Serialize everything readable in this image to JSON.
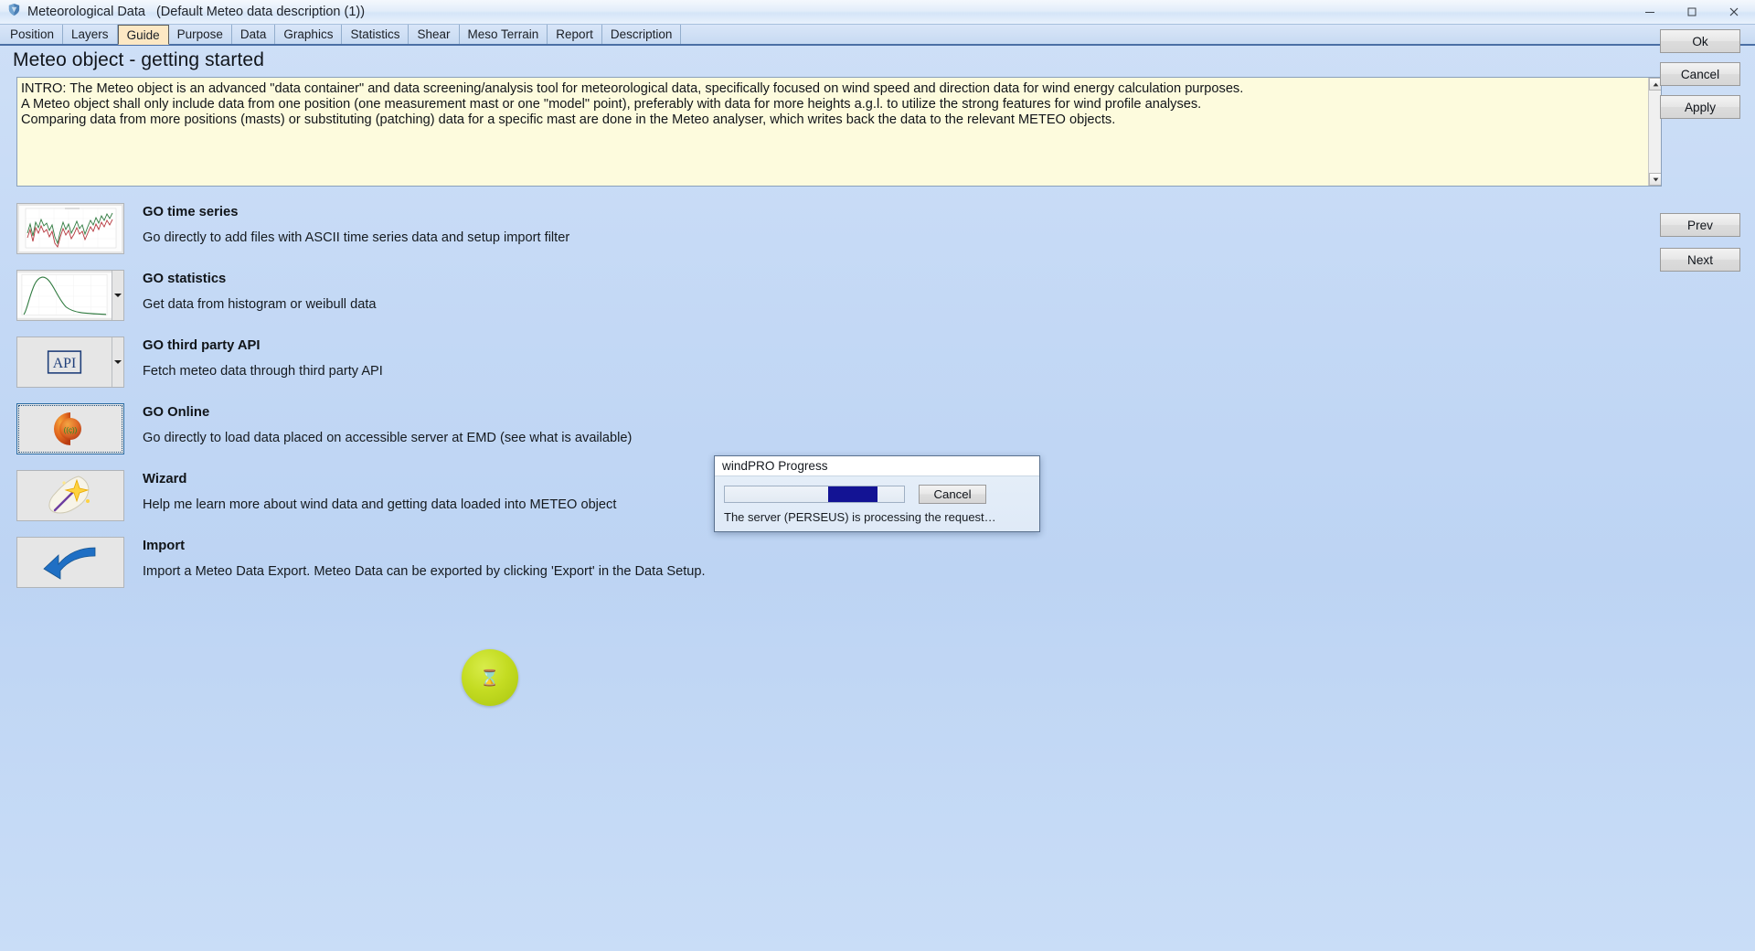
{
  "window": {
    "app_icon": "windpro-shield-icon",
    "title": "Meteorological Data",
    "subtitle": "(Default Meteo data description (1))",
    "minimize_label": "minimize-icon",
    "maximize_label": "maximize-icon",
    "close_label": "close-icon"
  },
  "tabs": [
    {
      "label": "Position",
      "active": false
    },
    {
      "label": "Layers",
      "active": false
    },
    {
      "label": "Guide",
      "active": true
    },
    {
      "label": "Purpose",
      "active": false
    },
    {
      "label": "Data",
      "active": false
    },
    {
      "label": "Graphics",
      "active": false
    },
    {
      "label": "Statistics",
      "active": false
    },
    {
      "label": "Shear",
      "active": false
    },
    {
      "label": "Meso Terrain",
      "active": false
    },
    {
      "label": "Report",
      "active": false
    },
    {
      "label": "Description",
      "active": false
    }
  ],
  "page": {
    "title": "Meteo object - getting started"
  },
  "intro": {
    "lines": [
      "INTRO: The Meteo object is an advanced \"data container\" and data screening/analysis tool for meteorological data, specifically focused on wind speed and direction data for wind energy calculation purposes.",
      "A Meteo object shall only include data from one position (one measurement mast or one \"model\" point), preferably with data for more heights a.g.l. to utilize the strong features for wind profile analyses.",
      "Comparing data from more positions (masts) or substituting (patching) data for a specific mast are done in the Meteo analyser, which writes back the data to the relevant METEO objects."
    ]
  },
  "options": [
    {
      "title": "GO time series",
      "desc": "Go directly to add files with ASCII time series data and setup import filter",
      "icon": "time-series-chart-icon",
      "has_dropdown": false,
      "selected": false
    },
    {
      "title": "GO statistics",
      "desc": "Get data from histogram or weibull data",
      "icon": "weibull-curve-icon",
      "has_dropdown": true,
      "selected": false
    },
    {
      "title": "GO third party API",
      "desc": "Fetch meteo data through third party API",
      "icon": "api-box-icon",
      "has_dropdown": true,
      "selected": false
    },
    {
      "title": "GO Online",
      "desc": "Go directly to load data placed on accessible server at EMD (see what is available)",
      "icon": "online-broadcast-icon",
      "has_dropdown": false,
      "selected": true
    },
    {
      "title": "Wizard",
      "desc": "Help me learn more about wind data and getting data loaded into METEO object",
      "icon": "magic-wand-icon",
      "has_dropdown": false,
      "selected": false
    },
    {
      "title": "Import",
      "desc": "Import a Meteo Data Export. Meteo Data can be exported by clicking 'Export' in the Data Setup.",
      "icon": "import-arrow-icon",
      "has_dropdown": false,
      "selected": false
    }
  ],
  "busy_indicator": {
    "icon": "hourglass-icon",
    "color": "#c4dc22"
  },
  "side_buttons": {
    "primary": [
      {
        "label": "Ok",
        "accel": "k"
      },
      {
        "label": "Cancel",
        "accel": "C"
      },
      {
        "label": "Apply",
        "accel": ""
      }
    ],
    "nav": [
      {
        "label": "Prev"
      },
      {
        "label": "Next"
      }
    ]
  },
  "progress_dialog": {
    "title": "windPRO Progress",
    "cancel_label": "Cancel",
    "status": "The server (PERSEUS) is processing the request…",
    "bar_color": "#131394",
    "bar_position_pct": 57
  },
  "scrollbar": {
    "up_icon": "chevron-up-icon",
    "down_icon": "chevron-down-icon"
  }
}
